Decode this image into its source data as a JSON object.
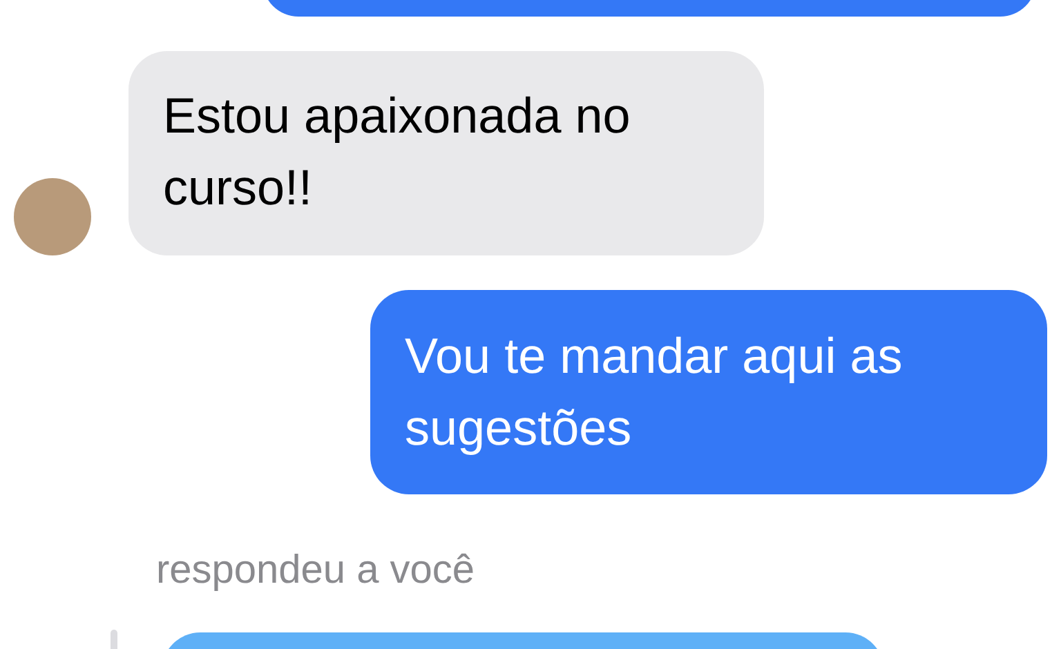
{
  "messages": [
    {
      "kind": "sent"
    },
    {
      "kind": "received",
      "text": "Estou apaixonada no curso!!",
      "avatar": true
    },
    {
      "kind": "sent",
      "text": "Vou te mandar aqui as sugestões"
    }
  ],
  "reply": {
    "caption": "respondeu a você"
  }
}
